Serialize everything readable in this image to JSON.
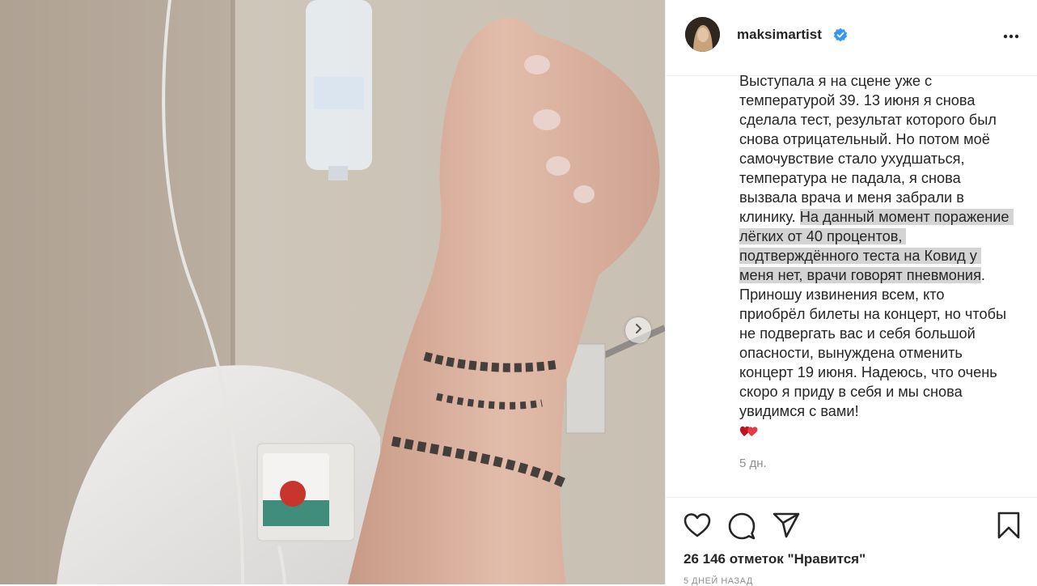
{
  "post": {
    "username": "maksimartist",
    "verified": true,
    "caption_before": "Выступала я на сцене уже с температурой 39. 13 июня я снова сделала тест, результат которого был снова отрицательный. Но потом моё самочувствие стало ухудшаться, температура не падала, я снова вызвала врача и меня забрали в клинику. ",
    "caption_highlight": "На данный момент поражение лёгких от 40 процентов, подтверждённого теста на Ковид у меня нет, врачи говорят пневмония",
    "caption_after": ". Приношу извинения всем, кто приобрёл билеты на концерт, но чтобы не подвергать вас и себя большой опасности, вынуждена отменить концерт 19 июня. Надеюсь, что очень скоро я приду в себя и мы снова увидимся с вами!",
    "caption_time": "5 дн.",
    "likes": "26 146 отметок \"Нравится\"",
    "posted_ago": "5 ДНЕЙ НАЗАД"
  },
  "icons": {
    "more": "more-horizontal-icon",
    "like": "heart-outline-icon",
    "comment": "comment-bubble-icon",
    "share": "paper-plane-icon",
    "save": "bookmark-icon",
    "next": "chevron-right-icon",
    "emoji": "red-hearts-emoji"
  },
  "colors": {
    "verified": "#3897f0",
    "text": "#262626",
    "muted": "#8e8e8e",
    "highlight": "#d4d4d4"
  }
}
